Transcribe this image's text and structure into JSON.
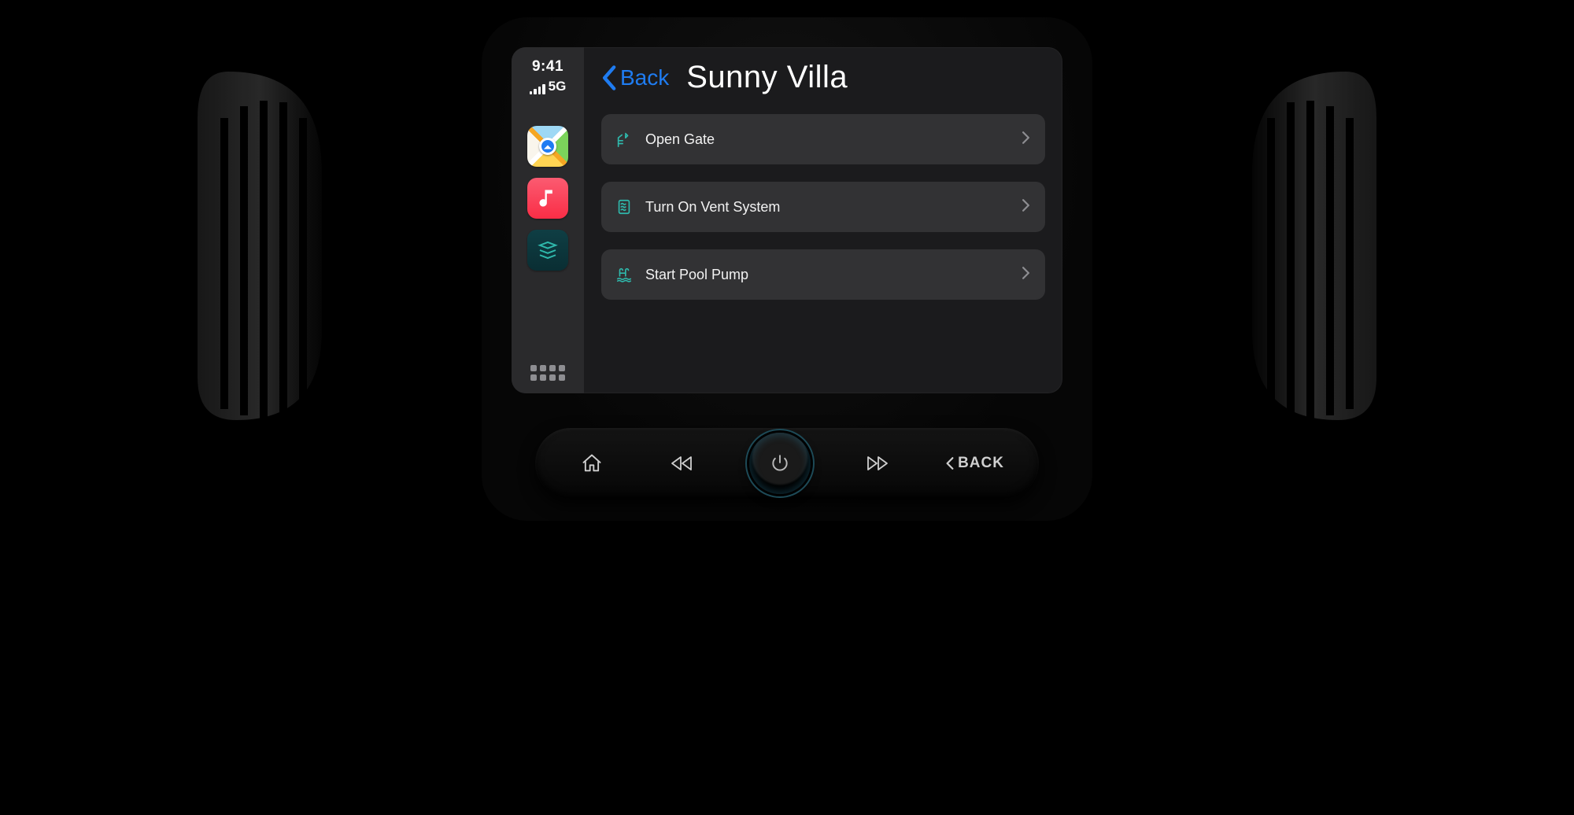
{
  "status": {
    "time": "9:41",
    "network": "5G"
  },
  "dock": {
    "apps": [
      {
        "name": "maps-app"
      },
      {
        "name": "music-app"
      },
      {
        "name": "home-app"
      }
    ]
  },
  "nav": {
    "back_label": "Back",
    "title": "Sunny Villa"
  },
  "actions": [
    {
      "icon": "gate-icon",
      "label": "Open Gate"
    },
    {
      "icon": "vent-icon",
      "label": "Turn On Vent System"
    },
    {
      "icon": "pool-icon",
      "label": "Start Pool Pump"
    }
  ],
  "physical": {
    "back_label": "BACK"
  },
  "colors": {
    "accent": "#1f7cf1",
    "action_icon": "#2fb9ac"
  }
}
